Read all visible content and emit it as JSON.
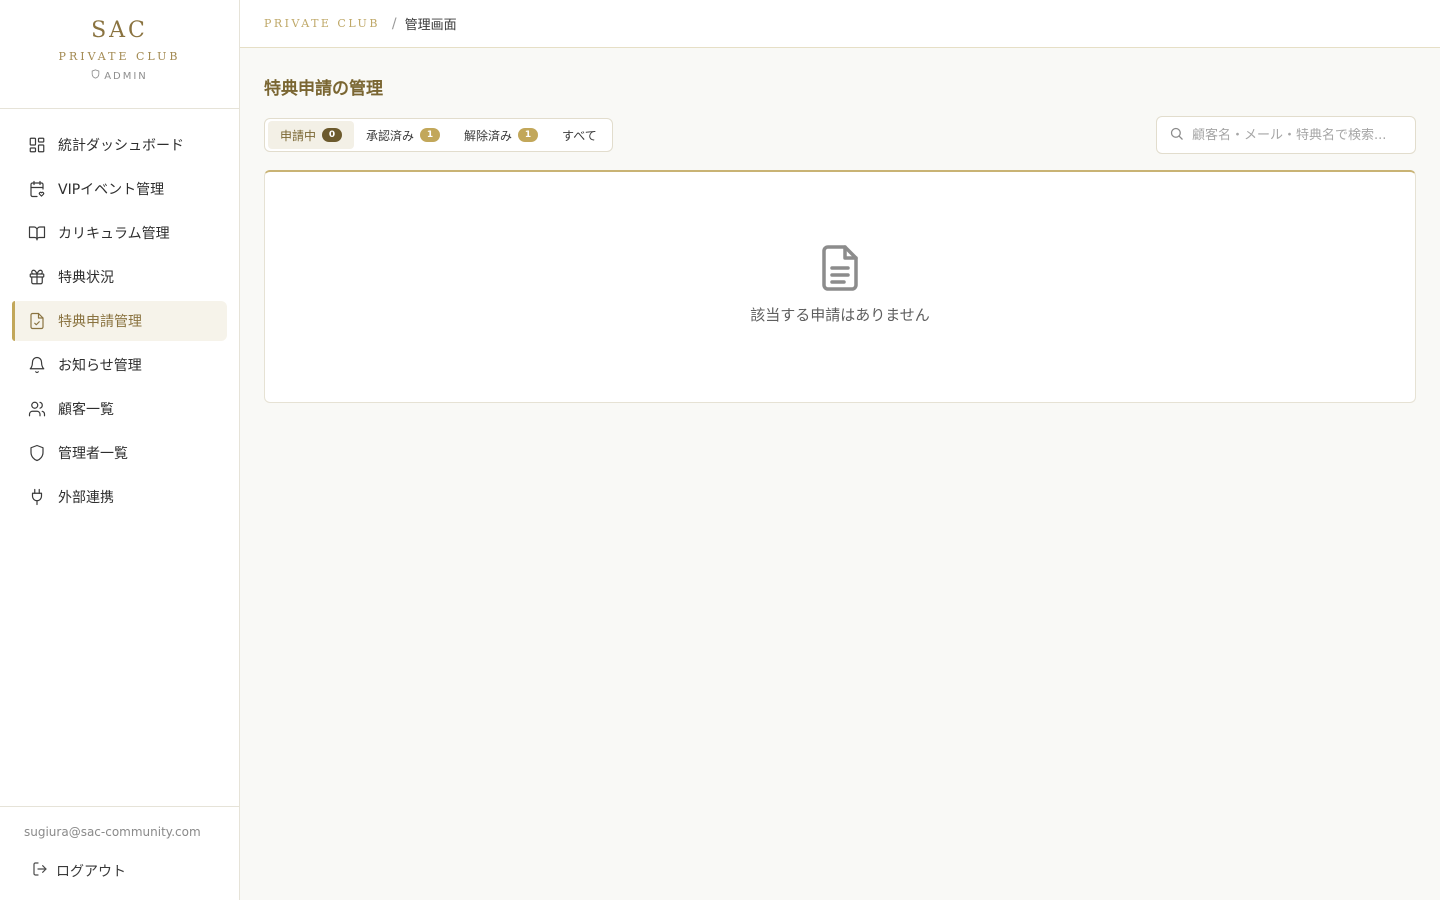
{
  "brand": {
    "title": "SAC",
    "subtitle": "PRIVATE CLUB",
    "role": "ADMIN"
  },
  "sidebar": {
    "items": [
      {
        "label": "統計ダッシュボード",
        "icon": "dashboard-icon"
      },
      {
        "label": "VIPイベント管理",
        "icon": "calendar-heart-icon"
      },
      {
        "label": "カリキュラム管理",
        "icon": "book-open-icon"
      },
      {
        "label": "特典状況",
        "icon": "gift-icon"
      },
      {
        "label": "特典申請管理",
        "icon": "file-check-icon",
        "active": true
      },
      {
        "label": "お知らせ管理",
        "icon": "bell-icon"
      },
      {
        "label": "顧客一覧",
        "icon": "users-icon"
      },
      {
        "label": "管理者一覧",
        "icon": "shield-icon"
      },
      {
        "label": "外部連携",
        "icon": "plug-icon"
      }
    ],
    "user_email": "sugiura@sac-community.com",
    "logout_label": "ログアウト"
  },
  "breadcrumb": {
    "club": "PRIVATE CLUB",
    "separator": "/",
    "page": "管理画面"
  },
  "main": {
    "title": "特典申請の管理",
    "tabs": [
      {
        "label": "申請中",
        "count": "0",
        "active": true
      },
      {
        "label": "承認済み",
        "count": "1"
      },
      {
        "label": "解除済み",
        "count": "1"
      },
      {
        "label": "すべて"
      }
    ],
    "search": {
      "placeholder": "顧客名・メール・特典名で検索..."
    },
    "empty_message": "該当する申請はありません"
  },
  "colors": {
    "accent": "#c2a75a",
    "accent_dark": "#7a6632",
    "background": "#f9f9f6"
  }
}
